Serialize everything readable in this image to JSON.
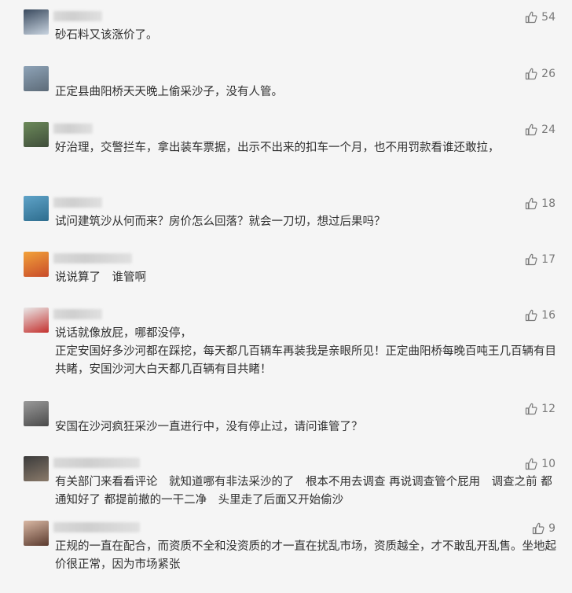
{
  "comments": [
    {
      "likes": "54",
      "text": "砂石料又该涨价了。",
      "avatar_colors": [
        "#3a4a5e",
        "#c9d4e0"
      ]
    },
    {
      "likes": "26",
      "text": "正定县曲阳桥天天晚上偷采沙子，没有人管。",
      "avatar_colors": [
        "#8ea3b7",
        "#5d6b78"
      ]
    },
    {
      "likes": "24",
      "text": "好治理，交警拦车，拿出装车票据，出示不出来的扣车一个月，也不用罚款看谁还敢拉，",
      "avatar_colors": [
        "#6c8a5a",
        "#3f4d3a"
      ]
    },
    {
      "likes": "18",
      "text": "试问建筑沙从何而来？房价怎么回落？就会一刀切，想过后果吗？",
      "avatar_colors": [
        "#5fa3c8",
        "#2e6d8e"
      ]
    },
    {
      "likes": "17",
      "text": "说说算了　谁管啊",
      "avatar_colors": [
        "#f2a23a",
        "#c84b2a"
      ]
    },
    {
      "likes": "16",
      "text": "说话就像放屁，哪都没停，\n正定安国好多沙河都在踩挖，每天都几百辆车再装我是亲眼所见！正定曲阳桥每晚百吨王几百辆有目共睹，安国沙河大白天都几百辆有目共睹！",
      "avatar_colors": [
        "#e9e9e9",
        "#c4312e"
      ]
    },
    {
      "likes": "12",
      "text": "安国在沙河疯狂采沙一直进行中，没有停止过，请问谁管了？",
      "avatar_colors": [
        "#9a9a9a",
        "#4a4a4a"
      ]
    },
    {
      "likes": "10",
      "text": "有关部门来看看评论　就知道哪有非法采沙的了　根本不用去调查 再说调查管个屁用　调查之前 都通知好了 都提前撤的一干二净　头里走了后面又开始偷沙",
      "avatar_colors": [
        "#3b3b3b",
        "#8a7a6a"
      ]
    },
    {
      "likes": "9",
      "text": "正规的一直在配合，而资质不全和没资质的才一直在扰乱市场，资质越全，才不敢乱开乱售。坐地起价很正常，因为市场紧张",
      "avatar_colors": [
        "#d9b8a4",
        "#5a3a2e"
      ]
    }
  ],
  "colors": {
    "background": "#f5f5f5",
    "text": "#2f2f2f",
    "meta": "#7a7a7a"
  }
}
